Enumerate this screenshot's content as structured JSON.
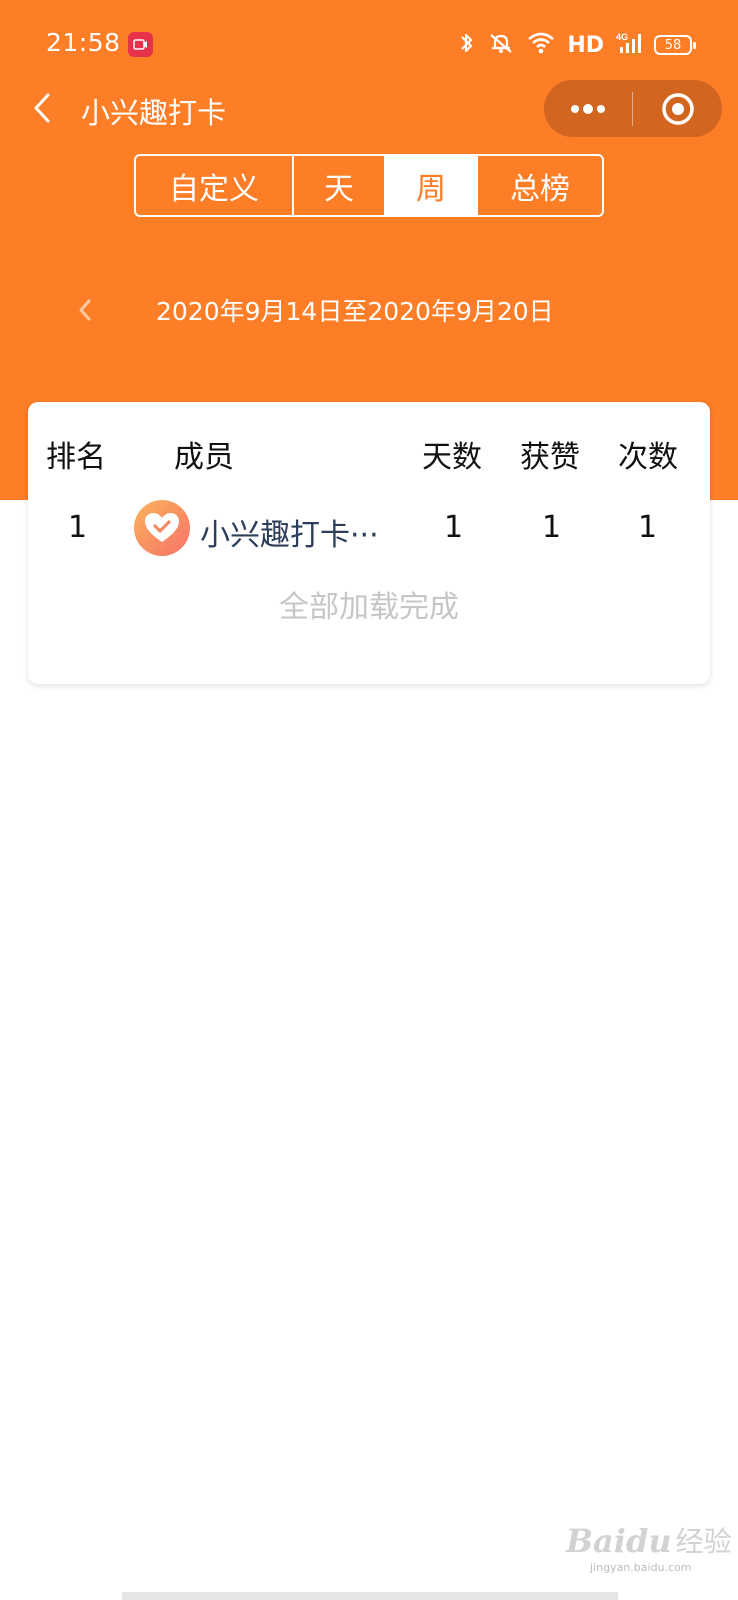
{
  "status_bar": {
    "time": "21:58",
    "network": "HD",
    "signal_label": "4G",
    "battery": "58"
  },
  "nav": {
    "title": "小兴趣打卡"
  },
  "tabs": [
    {
      "label": "自定义",
      "active": false
    },
    {
      "label": "天",
      "active": false
    },
    {
      "label": "周",
      "active": true
    },
    {
      "label": "总榜",
      "active": false
    }
  ],
  "date_range": "2020年9月14日至2020年9月20日",
  "table": {
    "headers": {
      "rank": "排名",
      "member": "成员",
      "days": "天数",
      "likes": "获赞",
      "count": "次数"
    },
    "rows": [
      {
        "rank": "1",
        "member": "小兴趣打卡···",
        "days": "1",
        "likes": "1",
        "count": "1"
      }
    ],
    "footer": "全部加载完成"
  },
  "watermark": {
    "brand": "Baidu",
    "cn": "经验",
    "url": "jingyan.baidu.com"
  },
  "colors": {
    "accent": "#fe7d27",
    "capsule": "#d26520",
    "member_name": "#2c3e5b",
    "muted": "#c6c6c6"
  }
}
